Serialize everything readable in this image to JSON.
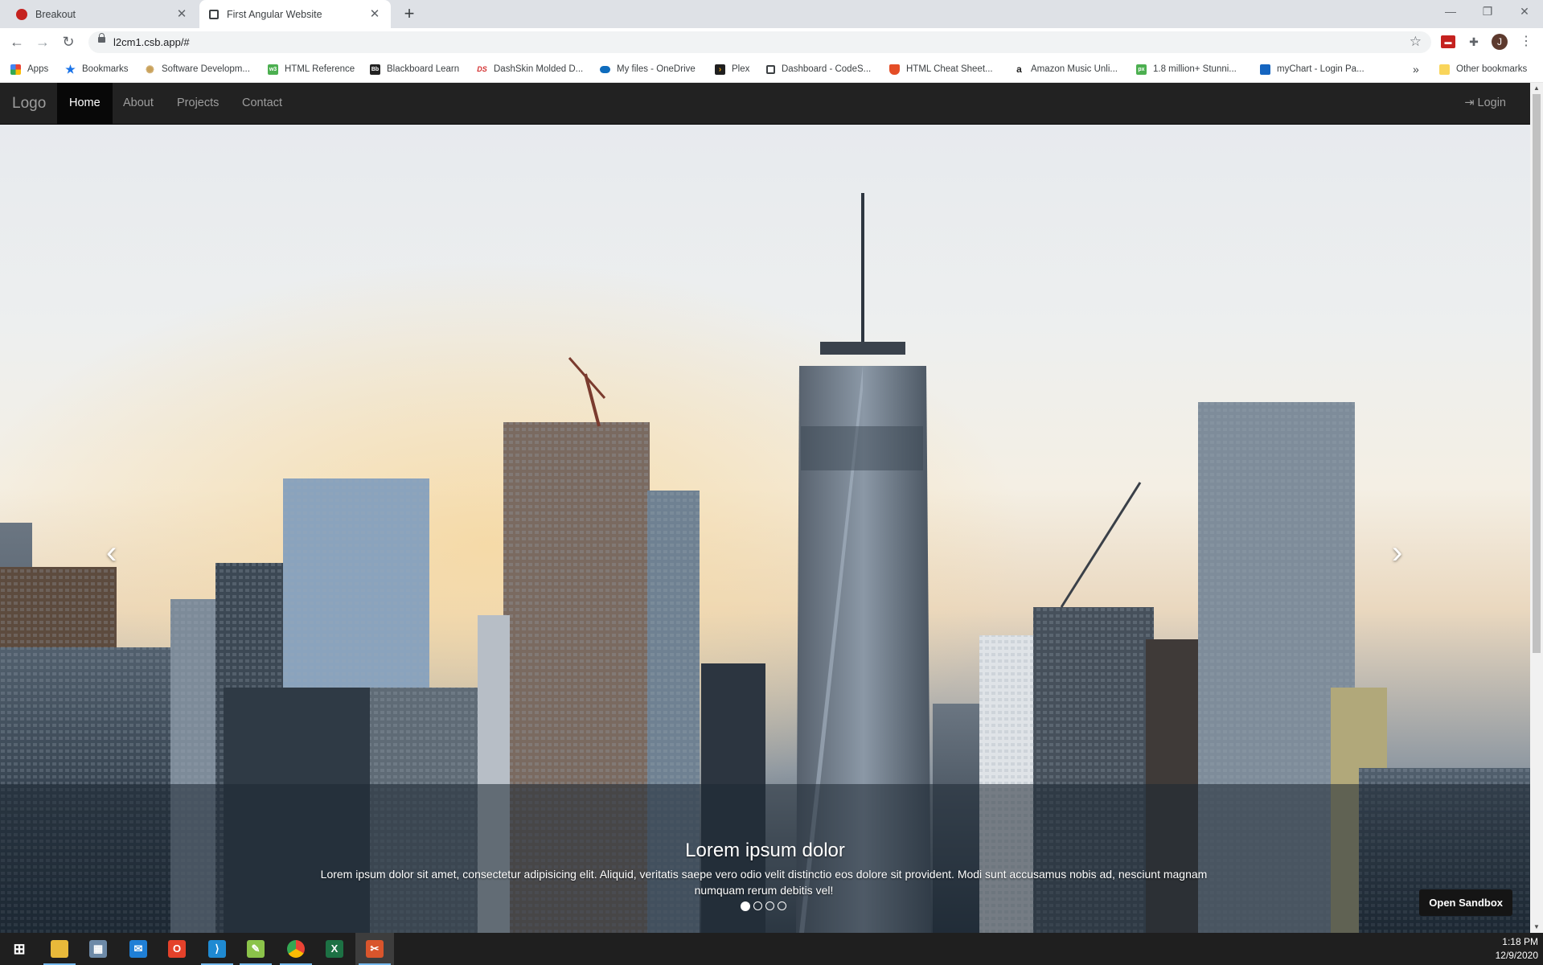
{
  "browser": {
    "tabs": [
      {
        "title": "Breakout",
        "favicon": "breakout-icon",
        "color": "#c5221f",
        "active": false
      },
      {
        "title": "First Angular Website",
        "favicon": "codesandbox-icon",
        "color": "#3c4043",
        "active": true
      }
    ],
    "url": "l2cm1.csb.app/#",
    "profile_initial": "J",
    "bookmarks": [
      {
        "label": "Apps",
        "icon": "apps-grid-icon"
      },
      {
        "label": "Bookmarks",
        "icon": "star-icon"
      },
      {
        "label": "Software Developm...",
        "icon": "gear-icon"
      },
      {
        "label": "HTML Reference",
        "icon": "w3-icon"
      },
      {
        "label": "Blackboard Learn",
        "icon": "blackboard-icon"
      },
      {
        "label": "DashSkin Molded D...",
        "icon": "dashskin-icon"
      },
      {
        "label": "My files - OneDrive",
        "icon": "onedrive-icon"
      },
      {
        "label": "Plex",
        "icon": "plex-icon"
      },
      {
        "label": "Dashboard - CodeS...",
        "icon": "codesandbox-icon"
      },
      {
        "label": "HTML Cheat Sheet...",
        "icon": "html5-icon"
      },
      {
        "label": "Amazon Music Unli...",
        "icon": "amazon-icon"
      },
      {
        "label": "1.8 million+ Stunni...",
        "icon": "pixabay-icon"
      },
      {
        "label": "myChart - Login Pa...",
        "icon": "mychart-icon"
      }
    ],
    "bookmarks_overflow": "»",
    "other_bookmarks": "Other bookmarks"
  },
  "site": {
    "brand": "Logo",
    "nav": [
      "Home",
      "About",
      "Projects",
      "Contact"
    ],
    "active_nav": "Home",
    "login": "Login",
    "carousel": {
      "title": "Lorem ipsum dolor",
      "text": "Lorem ipsum dolor sit amet, consectetur adipisicing elit. Aliquid, veritatis saepe vero odio velit distinctio eos dolore sit provident. Modi sunt accusamus nobis ad, nesciunt magnam numquam rerum debitis vel!",
      "slide_count": 4,
      "active_slide": 1,
      "prev": "‹",
      "next": "›"
    },
    "sandbox_button": "Open Sandbox"
  },
  "taskbar": {
    "apps": [
      "windows-start-icon",
      "file-explorer-icon",
      "calculator-icon",
      "mail-icon",
      "office-icon",
      "vscode-icon",
      "notepad-icon",
      "chrome-icon",
      "excel-icon",
      "snipping-tool-icon"
    ],
    "time": "1:18 PM",
    "date": "12/9/2020"
  }
}
